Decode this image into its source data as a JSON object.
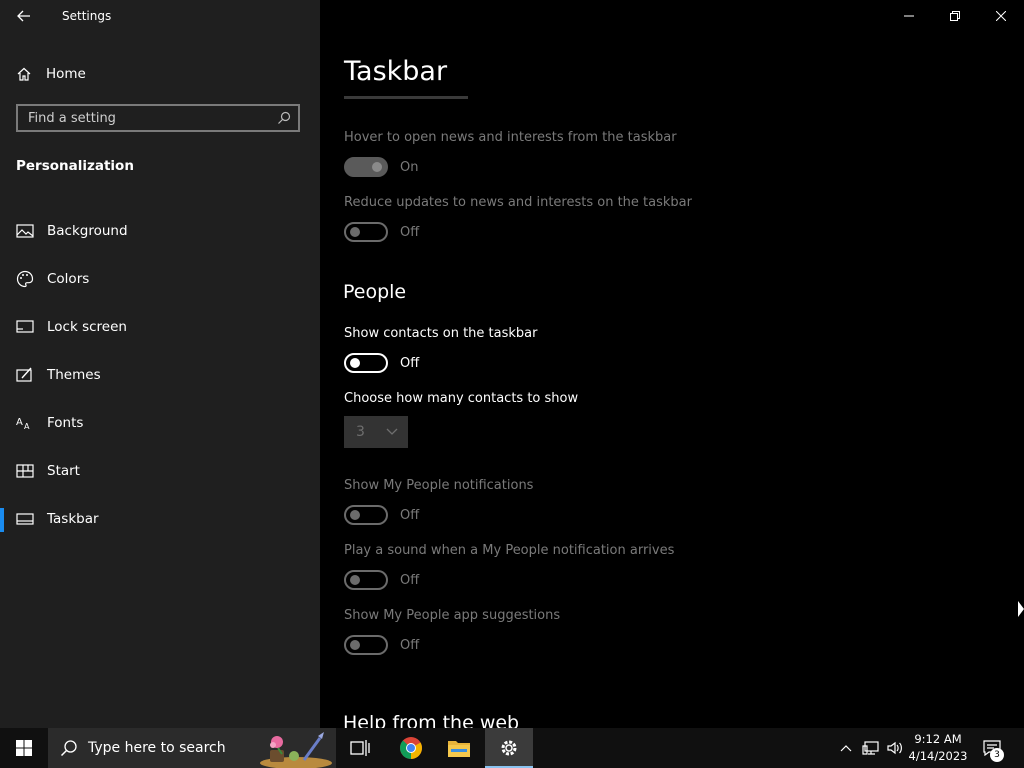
{
  "window": {
    "title": "Settings"
  },
  "sidebar": {
    "home_label": "Home",
    "search_placeholder": "Find a setting",
    "section_title": "Personalization",
    "items": [
      {
        "label": "Background",
        "icon": "picture-icon"
      },
      {
        "label": "Colors",
        "icon": "palette-icon"
      },
      {
        "label": "Lock screen",
        "icon": "lock-screen-icon"
      },
      {
        "label": "Themes",
        "icon": "themes-icon"
      },
      {
        "label": "Fonts",
        "icon": "fonts-icon"
      },
      {
        "label": "Start",
        "icon": "start-icon"
      },
      {
        "label": "Taskbar",
        "icon": "taskbar-icon",
        "active": true
      }
    ]
  },
  "main": {
    "title": "Taskbar",
    "news": {
      "hover_label": "Hover to open news and interests from the taskbar",
      "hover_state": "On",
      "reduce_label": "Reduce updates to news and interests on the taskbar",
      "reduce_state": "Off"
    },
    "people": {
      "heading": "People",
      "show_contacts_label": "Show contacts on the taskbar",
      "show_contacts_state": "Off",
      "contacts_count_label": "Choose how many contacts to show",
      "contacts_count_value": "3",
      "notifications_label": "Show My People notifications",
      "notifications_state": "Off",
      "sound_label": "Play a sound when a My People notification arrives",
      "sound_state": "Off",
      "suggestions_label": "Show My People app suggestions",
      "suggestions_state": "Off"
    },
    "help_heading": "Help from the web"
  },
  "taskbar": {
    "search_placeholder": "Type here to search",
    "time": "9:12 AM",
    "date": "4/14/2023",
    "notification_count": "3"
  },
  "colors": {
    "accent": "#1a8cf0",
    "sidebar_bg": "#1f1f1f",
    "content_bg": "#000000"
  }
}
